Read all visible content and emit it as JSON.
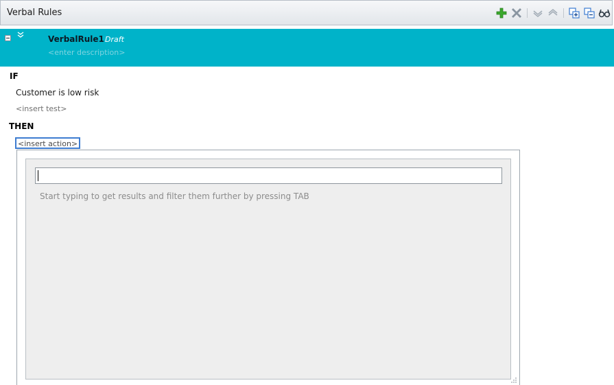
{
  "panel": {
    "title": "Verbal Rules",
    "toolbar": [
      {
        "icon": "add-icon",
        "color": "#3aa82c"
      },
      {
        "icon": "delete-icon",
        "color": "#7d8a96"
      },
      {
        "icon": "move-down-icon",
        "color": "#9ba6b1"
      },
      {
        "icon": "move-up-icon",
        "color": "#9ba6b1"
      },
      {
        "icon": "expand-all-icon",
        "color": "#3d7cd0"
      },
      {
        "icon": "collapse-all-icon",
        "color": "#3d7cd0"
      },
      {
        "icon": "view-icon",
        "color": "#2f3b46"
      }
    ]
  },
  "rule": {
    "name": "VerbalRule1",
    "status": "Draft",
    "description_placeholder": "<enter description>",
    "accent_color": "#00b3c9"
  },
  "body": {
    "if_keyword": "IF",
    "condition": "Customer is low risk",
    "insert_test": "<insert test>",
    "then_keyword": "THEN",
    "insert_action": "<insert action>"
  },
  "popup": {
    "input_value": "",
    "hint": "Start typing to get results and filter them further by pressing TAB"
  }
}
